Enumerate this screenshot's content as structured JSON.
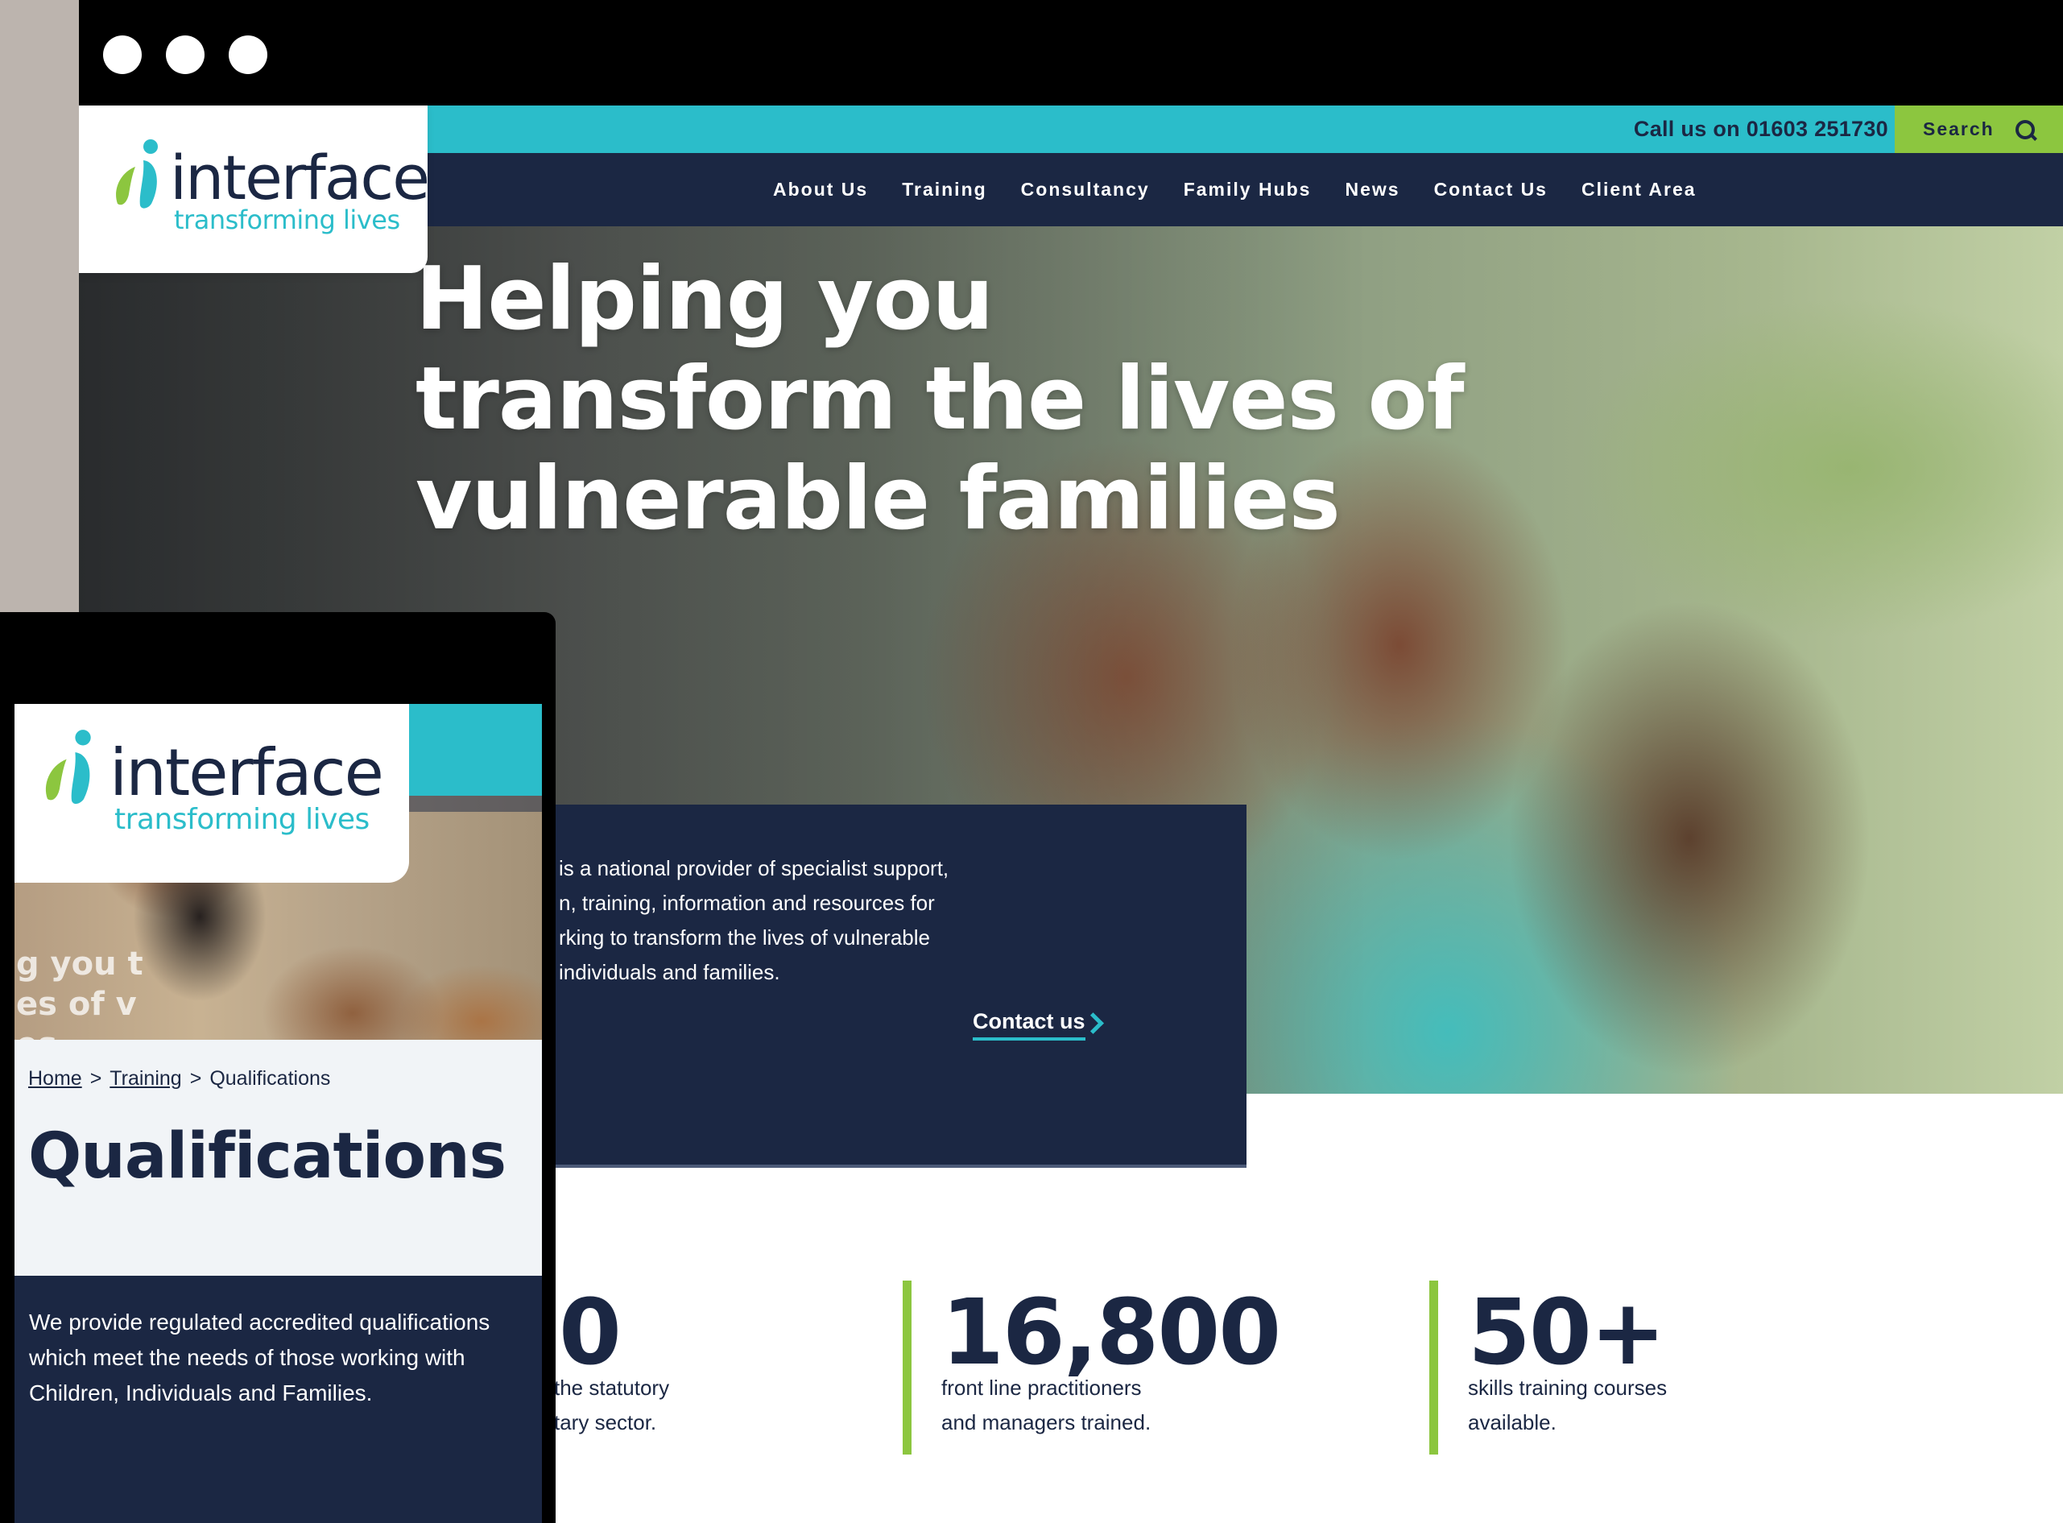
{
  "desktop": {
    "topbar": {
      "phone": "Call us on 01603 251730",
      "search_label": "Search"
    },
    "logo": {
      "wordmark": "interface",
      "tagline": "transforming lives"
    },
    "nav": [
      "About Us",
      "Training",
      "Consultancy",
      "Family Hubs",
      "News",
      "Contact Us",
      "Client Area"
    ],
    "hero": {
      "title_lines": [
        "Helping you",
        "transform the lives of",
        "vulnerable families"
      ],
      "body_lines": [
        "is a national provider of specialist support,",
        "n, training, information and resources for",
        "rking to transform the lives of vulnerable",
        "individuals and families."
      ],
      "cta": "Contact us"
    },
    "stats": [
      {
        "value": "0",
        "desc_lines": [
          "the statutory",
          "tary sector."
        ]
      },
      {
        "value": "16,800",
        "desc_lines": [
          "front line practitioners",
          "and managers trained."
        ]
      },
      {
        "value": "50+",
        "desc_lines": [
          "skills training courses",
          "available."
        ]
      }
    ]
  },
  "mobile": {
    "logo": {
      "wordmark": "interface",
      "tagline": "transforming lives"
    },
    "hero_overlay_lines": [
      "g you t",
      "es of v",
      "es"
    ],
    "breadcrumb": {
      "home": "Home",
      "training": "Training",
      "current": "Qualifications",
      "separator": ">"
    },
    "title": "Qualifications",
    "description": "We provide regulated accredited qualifications which meet the needs of those working with Children, Individuals and Families."
  },
  "colors": {
    "navy": "#1b2743",
    "teal": "#2bbdca",
    "green": "#8cc63f"
  }
}
